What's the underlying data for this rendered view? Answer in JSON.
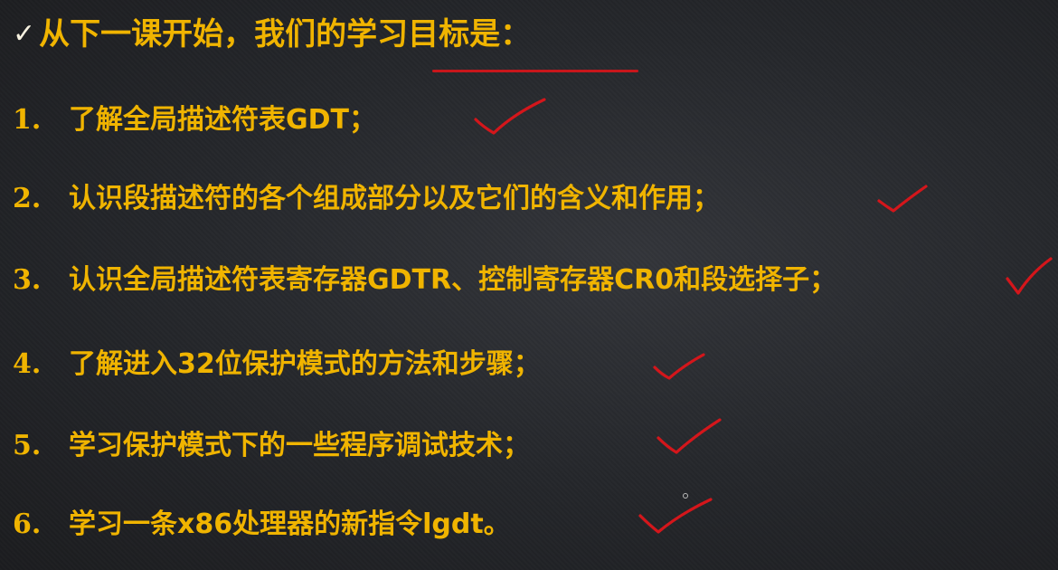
{
  "slide": {
    "title_check": "✓",
    "title": "从下一课开始，我们的学习目标是：",
    "items": [
      {
        "num": "1.",
        "text": "了解全局描述符表GDT；"
      },
      {
        "num": "2.",
        "text": "认识段描述符的各个组成部分以及它们的含义和作用；"
      },
      {
        "num": "3.",
        "text": "认识全局描述符表寄存器GDTR、控制寄存器CR0和段选择子；"
      },
      {
        "num": "4.",
        "text": "了解进入32位保护模式的方法和步骤；"
      },
      {
        "num": "5.",
        "text": "学习保护模式下的一些程序调试技术；"
      },
      {
        "num": "6.",
        "text": "学习一条x86处理器的新指令lgdt。"
      }
    ],
    "annotation_color": "#d4161b",
    "text_color": "#f0b400"
  }
}
